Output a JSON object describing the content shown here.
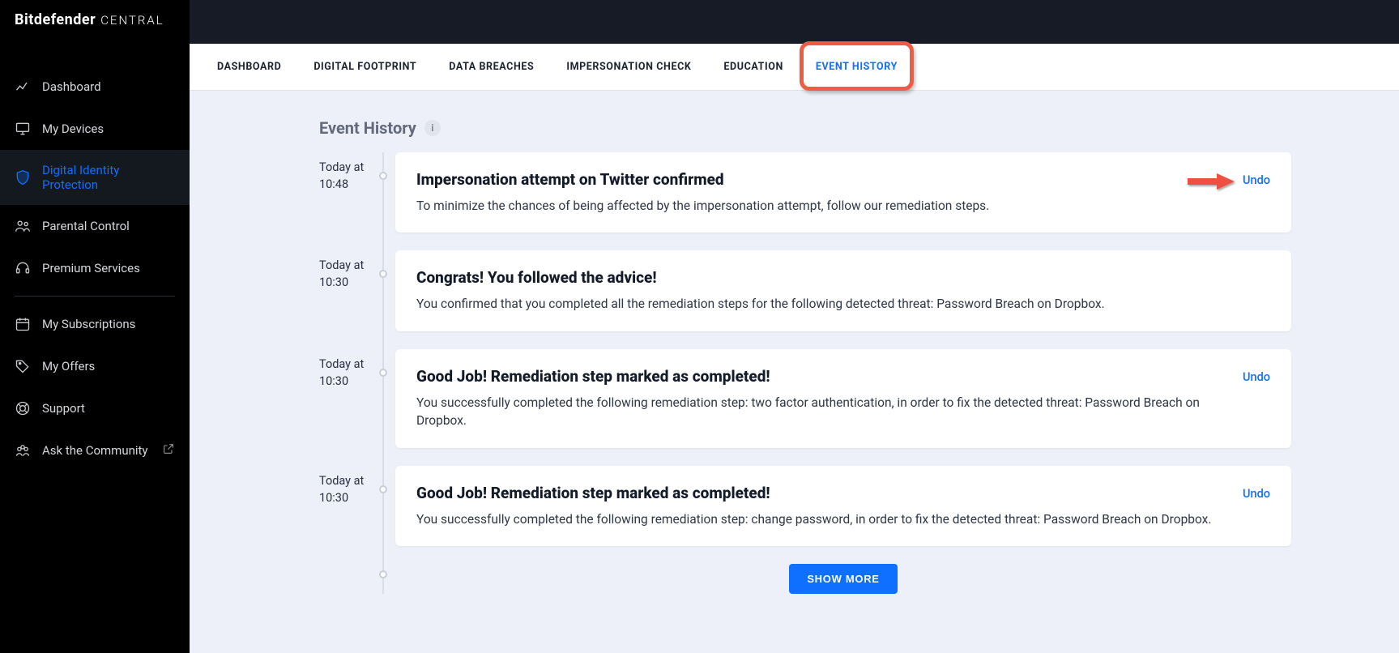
{
  "brand": {
    "main": "Bitdefender",
    "sub": "CENTRAL"
  },
  "sidebar": {
    "items": [
      {
        "label": "Dashboard",
        "icon": "dashboard"
      },
      {
        "label": "My Devices",
        "icon": "monitor"
      },
      {
        "label": "Digital Identity Protection",
        "icon": "shield",
        "active": true
      },
      {
        "label": "Parental Control",
        "icon": "people"
      },
      {
        "label": "Premium Services",
        "icon": "headset"
      },
      {
        "label": "My Subscriptions",
        "icon": "calendar",
        "divider_before": true
      },
      {
        "label": "My Offers",
        "icon": "tag"
      },
      {
        "label": "Support",
        "icon": "lifebuoy"
      },
      {
        "label": "Ask the Community",
        "icon": "community",
        "external": true
      }
    ]
  },
  "tabs": [
    {
      "label": "DASHBOARD"
    },
    {
      "label": "DIGITAL FOOTPRINT"
    },
    {
      "label": "DATA BREACHES"
    },
    {
      "label": "IMPERSONATION CHECK"
    },
    {
      "label": "EDUCATION"
    },
    {
      "label": "EVENT HISTORY",
      "active": true,
      "highlighted": true
    }
  ],
  "page": {
    "title": "Event History",
    "show_more_label": "SHOW MORE"
  },
  "events": [
    {
      "time_prefix": "Today at",
      "time": "10:48",
      "title": "Impersonation attempt on Twitter confirmed",
      "desc": "To minimize the chances of being affected by the impersonation attempt, follow our remediation steps.",
      "undo": "Undo",
      "arrow": true
    },
    {
      "time_prefix": "Today at",
      "time": "10:30",
      "title": "Congrats! You followed the advice!",
      "desc": "You confirmed that you completed all the remediation steps for the following detected threat: Password Breach on Dropbox."
    },
    {
      "time_prefix": "Today at",
      "time": "10:30",
      "title": "Good Job! Remediation step marked as completed!",
      "desc": "You successfully completed the following remediation step: two factor authentication, in order to fix the detected threat: Password Breach on Dropbox.",
      "undo": "Undo"
    },
    {
      "time_prefix": "Today at",
      "time": "10:30",
      "title": "Good Job! Remediation step marked as completed!",
      "desc": "You successfully completed the following remediation step: change password, in order to fix the detected threat: Password Breach on Dropbox.",
      "undo": "Undo"
    }
  ],
  "colors": {
    "accent": "#0f6fff",
    "highlight": "#ee5c44"
  }
}
